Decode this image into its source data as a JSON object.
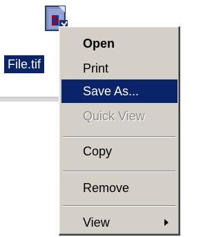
{
  "desktop": {
    "file_icon": "tif-image-file-icon",
    "file_label": "File.tif"
  },
  "context_menu": {
    "items": [
      {
        "label": "Open",
        "state": "default-bold"
      },
      {
        "label": "Print",
        "state": "normal"
      },
      {
        "label": "Save As...",
        "state": "highlighted"
      },
      {
        "label": "Quick View",
        "state": "disabled"
      },
      {
        "label": "Copy",
        "state": "normal"
      },
      {
        "label": "Remove",
        "state": "normal"
      },
      {
        "label": "View",
        "state": "normal",
        "submenu_icon": "chevron-right-icon"
      }
    ]
  },
  "colors": {
    "menu_background": "#d4d0c8",
    "selection_background": "#0a246a",
    "selection_text": "#ffffff",
    "disabled_text": "#8d8d8d"
  }
}
